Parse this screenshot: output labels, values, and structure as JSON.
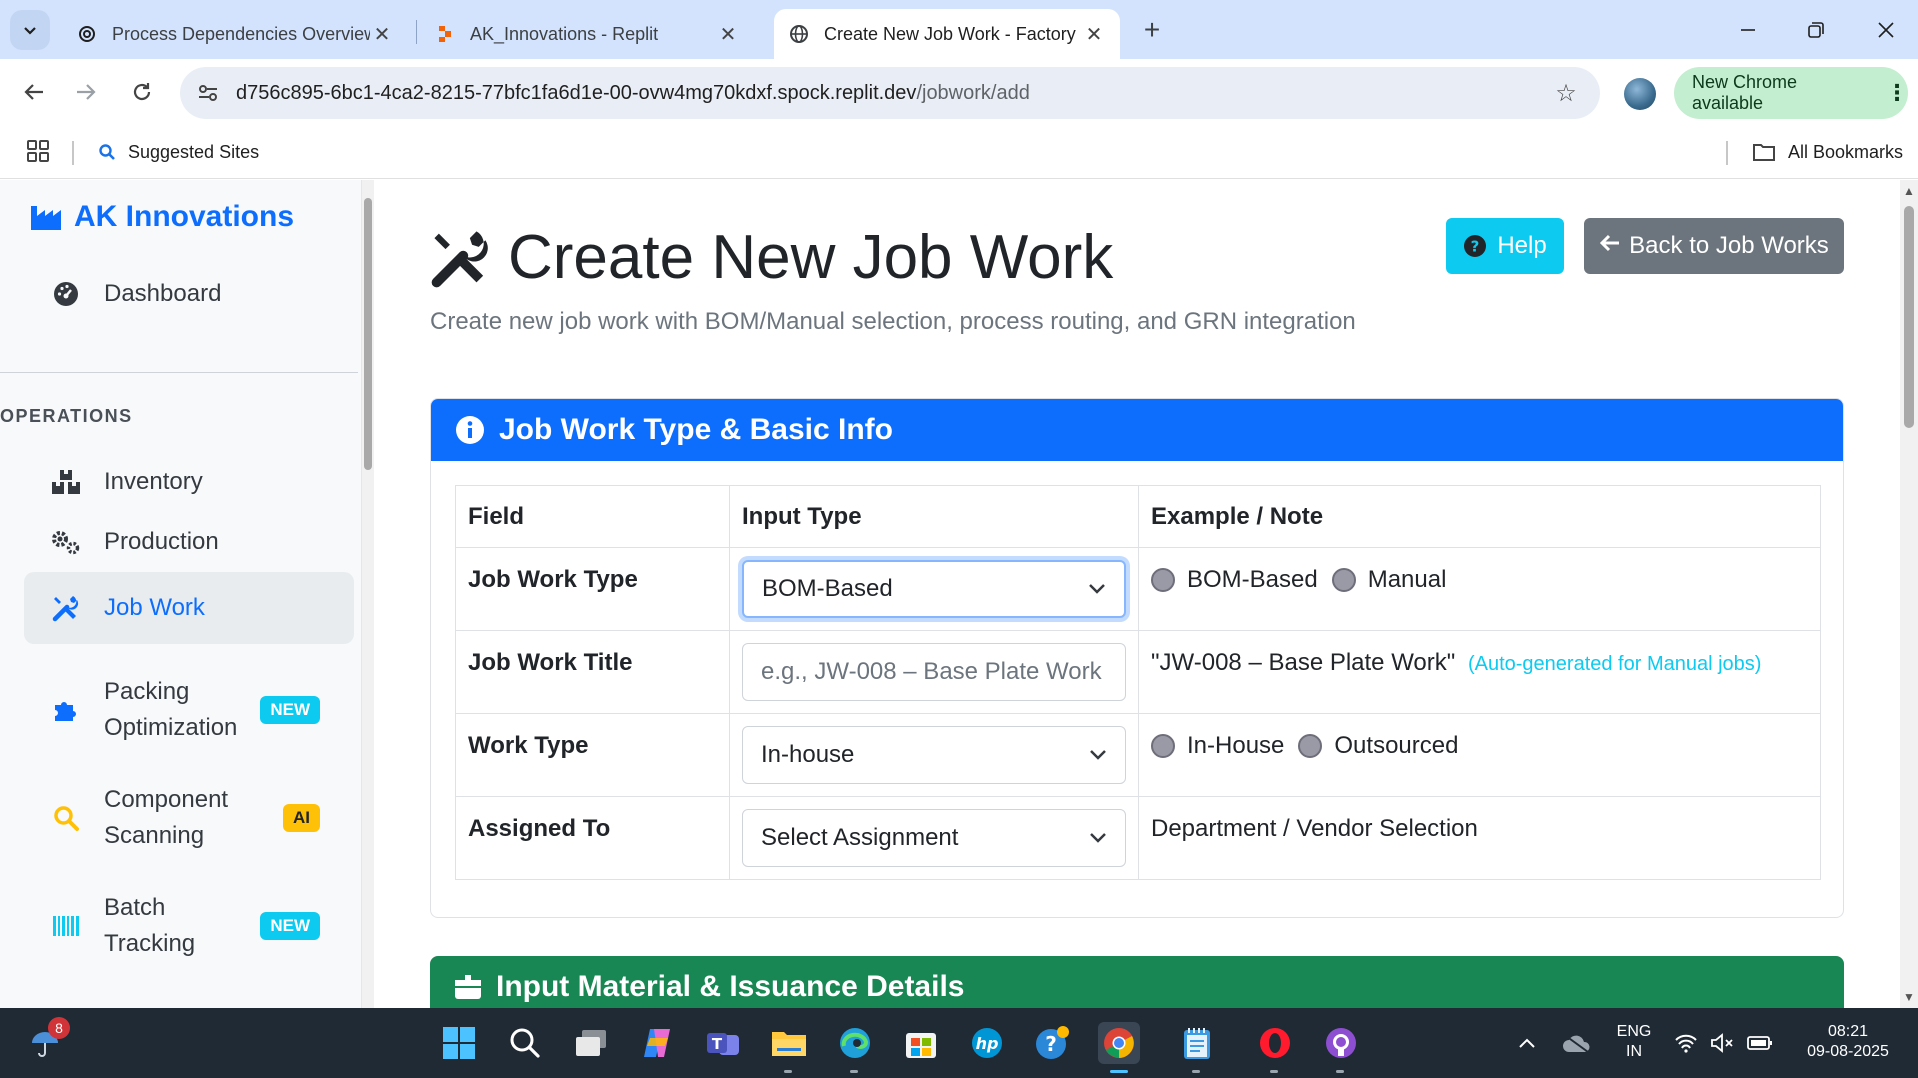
{
  "browser": {
    "tabs": [
      {
        "title": "Process Dependencies Overview",
        "icon": "openai-icon"
      },
      {
        "title": "AK_Innovations - Replit",
        "icon": "replit-icon"
      },
      {
        "title": "Create New Job Work - Factory",
        "icon": "globe-icon"
      }
    ],
    "url_host": "d756c895-6bc1-4ca2-8215-77bfc1fa6d1e-00-ovw4mg70kdxf.spock.replit.dev",
    "url_path": "/jobwork/add",
    "update_label": "New Chrome available",
    "bookmarks": {
      "suggested": "Suggested Sites",
      "all": "All Bookmarks"
    }
  },
  "sidebar": {
    "brand": "AK Innovations",
    "dashboard": "Dashboard",
    "section_heading": "OPERATIONS",
    "items": [
      {
        "label": "Inventory",
        "icon": "boxes-icon"
      },
      {
        "label": "Production",
        "icon": "cogs-icon"
      },
      {
        "label": "Job Work",
        "icon": "tools-icon",
        "active": true
      },
      {
        "label_line1": "Packing",
        "label_line2": "Optimization",
        "badge": "NEW",
        "icon": "puzzle-icon"
      },
      {
        "label_line1": "Component",
        "label_line2": "Scanning",
        "badge": "AI",
        "icon": "search-icon"
      },
      {
        "label_line1": "Batch",
        "label_line2": "Tracking",
        "badge": "NEW",
        "icon": "barcode-icon"
      }
    ]
  },
  "page": {
    "title": "Create New Job Work",
    "subtitle": "Create new job work with BOM/Manual selection, process routing, and GRN integration",
    "help_label": "Help",
    "back_label": "Back to Job Works"
  },
  "card1": {
    "header": "Job Work Type & Basic Info",
    "columns": [
      "Field",
      "Input Type",
      "Example / Note"
    ],
    "rows": [
      {
        "field": "Job Work Type",
        "input_value": "BOM-Based",
        "options": [
          "BOM-Based",
          "Manual"
        ]
      },
      {
        "field": "Job Work Title",
        "placeholder": "e.g., JW-008 – Base Plate Work",
        "note": "\"JW-008 – Base Plate Work\"",
        "hint": "(Auto-generated for Manual jobs)"
      },
      {
        "field": "Work Type",
        "input_value": "In-house",
        "options": [
          "In-House",
          "Outsourced"
        ]
      },
      {
        "field": "Assigned To",
        "input_value": "Select Assignment",
        "note": "Department / Vendor Selection"
      }
    ]
  },
  "card2": {
    "header": "Input Material & Issuance Details"
  },
  "taskbar": {
    "notification_count": "8",
    "lang_line1": "ENG",
    "lang_line2": "IN",
    "time": "08:21",
    "date": "09-08-2025"
  },
  "colors": {
    "primary": "#0d6efd",
    "success": "#198754",
    "info": "#0dcaf0",
    "warning": "#ffc107",
    "secondary": "#6c757d"
  }
}
